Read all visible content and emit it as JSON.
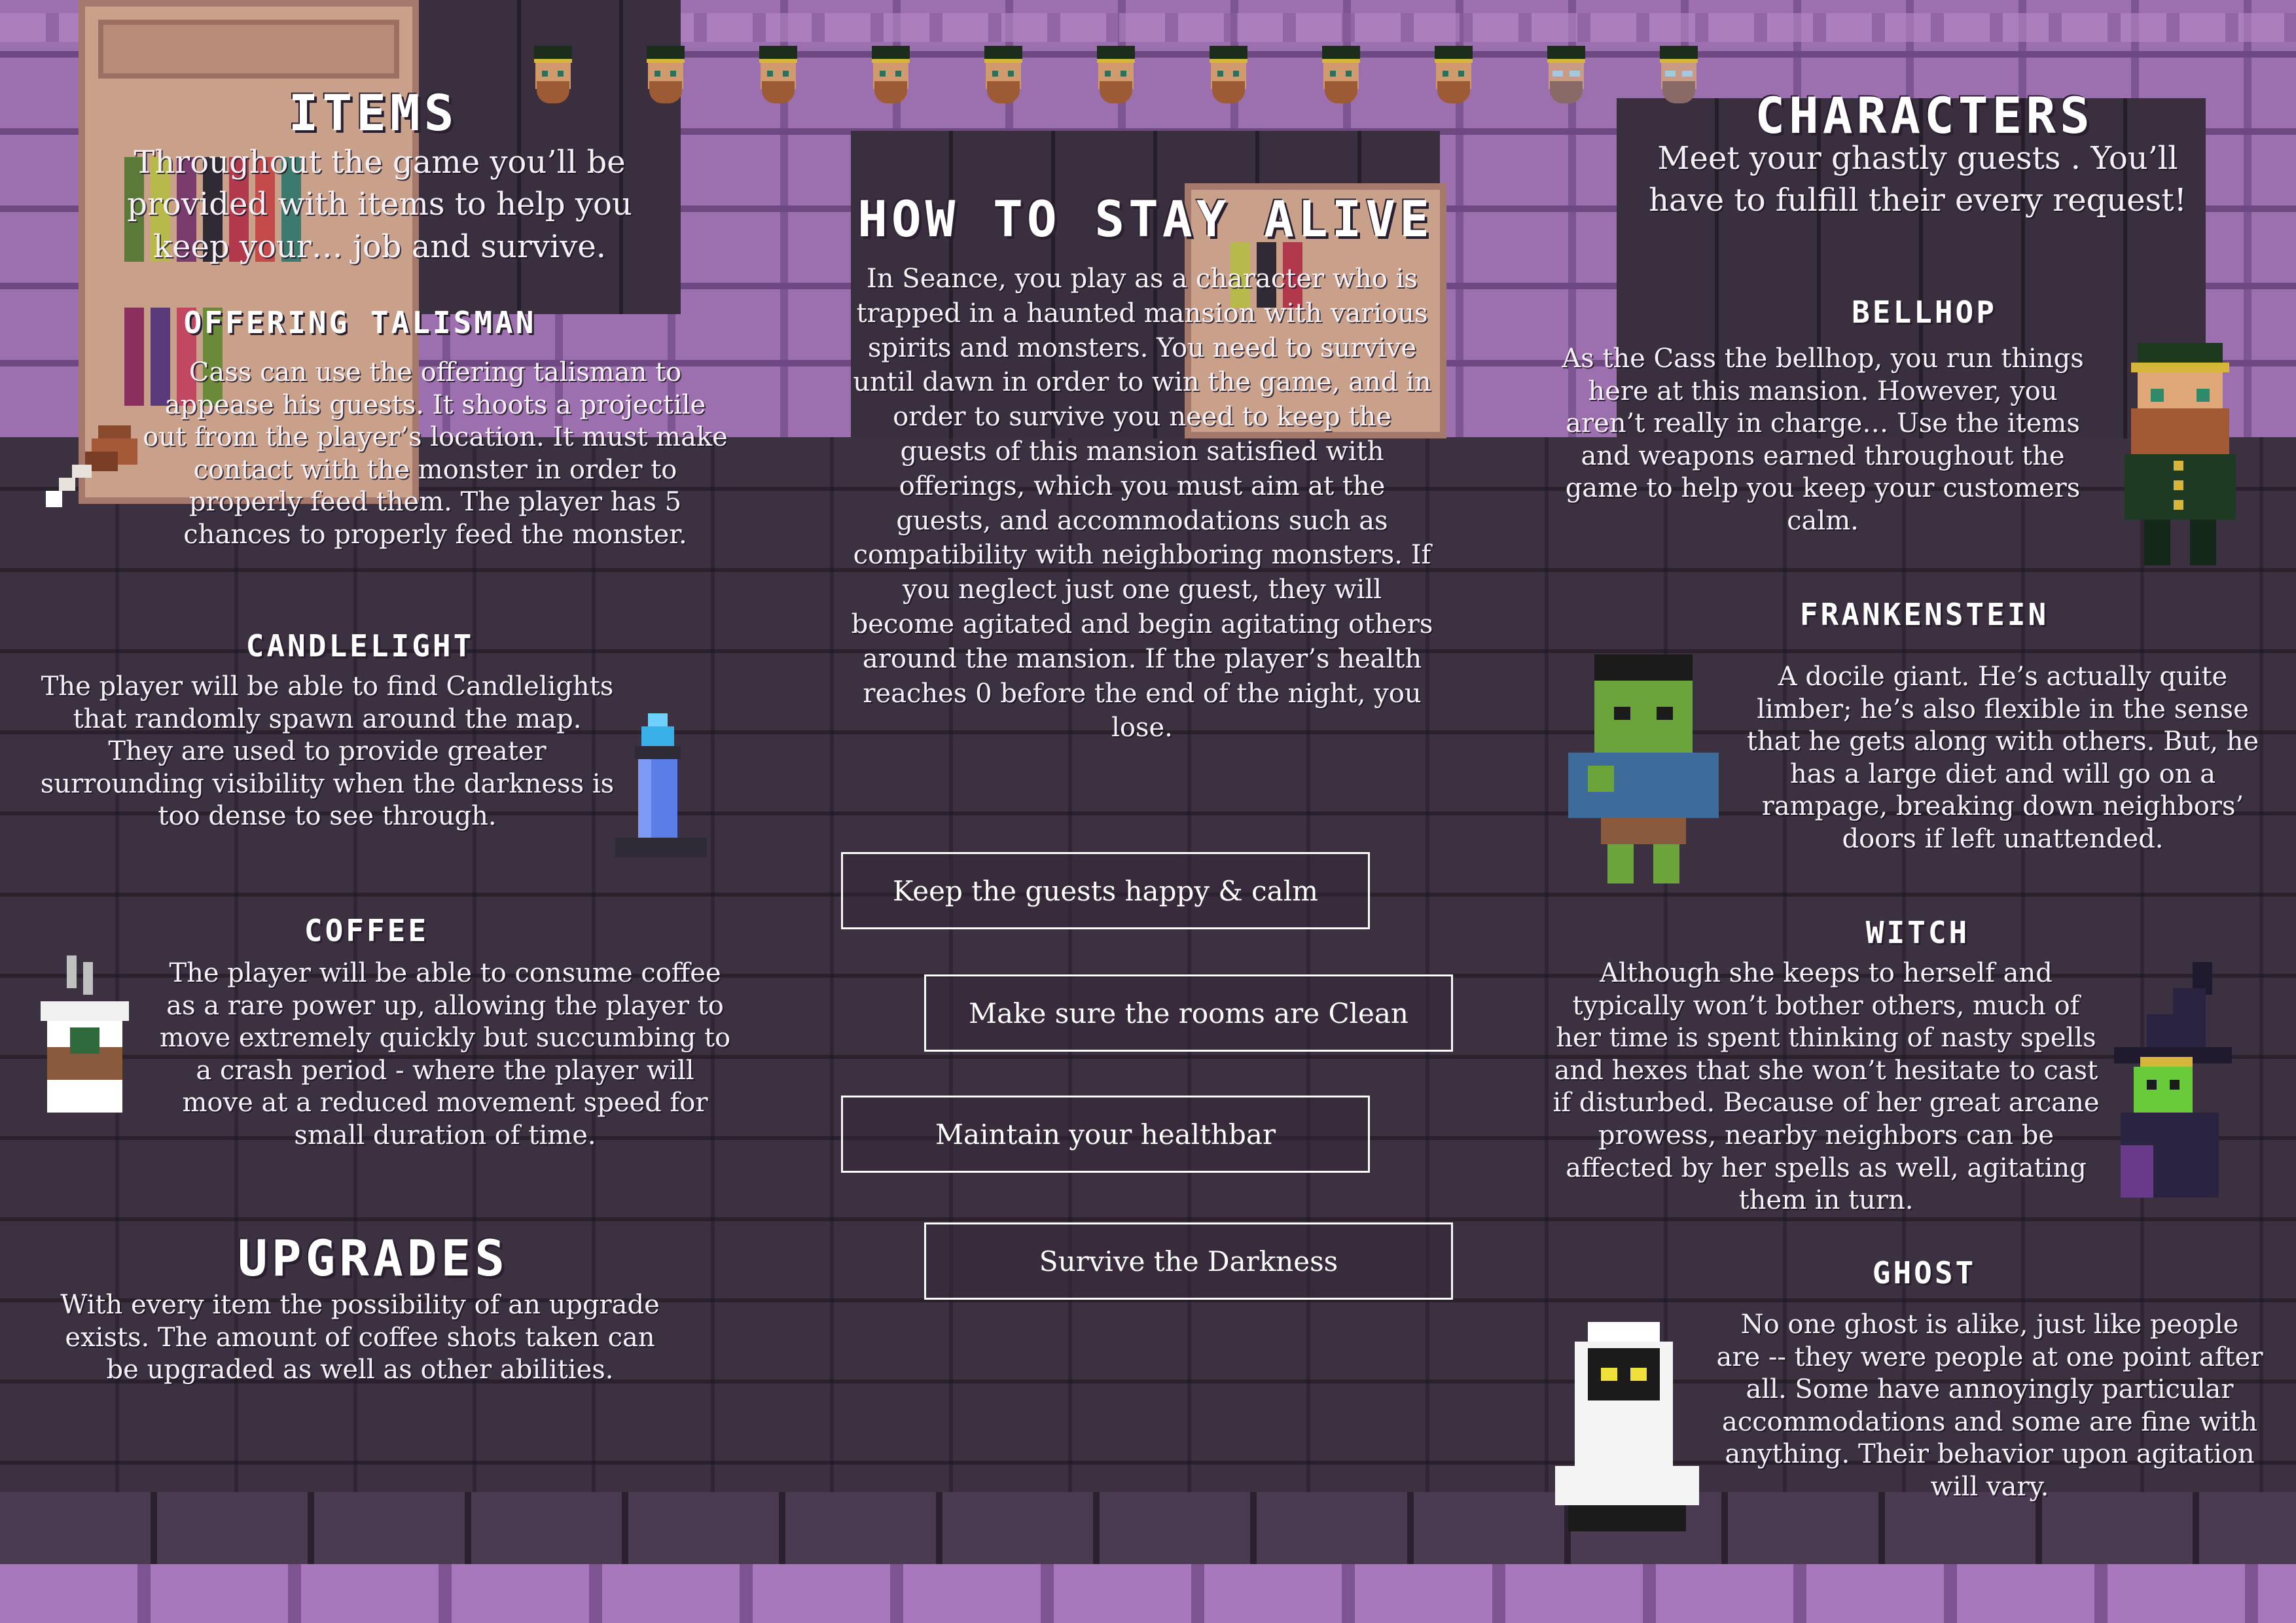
{
  "items": {
    "heading": "ITEMS",
    "intro": "Throughout the game you’ll be provided with items to help you keep your… job and survive.",
    "offering": {
      "title": "OFFERING TALISMAN",
      "text": "Cass can use the offering talisman to appease his guests. It shoots a projectile out from the player’s location. It must make contact with the monster in order to properly feed them. The player has 5 chances to properly feed the monster."
    },
    "candlelight": {
      "title": "CANDLELIGHT",
      "text": "The player will be able to find Candlelights that randomly spawn around the map. They are used to provide greater surrounding visibility when the darkness is too dense to see through."
    },
    "coffee": {
      "title": "COFFEE",
      "text": "The player will be able to consume coffee as a rare power up, allowing the player to move extremely quickly but succumbing to a crash period - where the player will move at a reduced movement speed for small duration of time."
    }
  },
  "upgrades": {
    "heading": "UPGRADES",
    "text": "With every item the possibility of an upgrade exists. The amount of coffee shots taken can be upgraded as well as other abilities."
  },
  "stay_alive": {
    "heading": "HOW TO STAY ALIVE",
    "text": "In Seance, you play as a character who is trapped in a haunted mansion with various spirits and monsters. You need to survive until dawn in order to win the game, and in order to survive you need to keep the guests of this mansion satisfied with offerings, which you must aim at the guests, and accommodations such as compatibility with neighboring monsters. If you neglect just one guest, they will become agitated and begin agitating others around the mansion. If the player’s health reaches 0 before the end of the night, you lose.",
    "goals": [
      "Keep the guests happy & calm",
      "Make sure the rooms are Clean",
      "Maintain your healthbar",
      "Survive the Darkness"
    ]
  },
  "characters": {
    "heading": "CHARACTERS",
    "intro": "Meet your ghastly guests . You’ll have to fulfill their every request!",
    "bellhop": {
      "title": "BELLHOP",
      "text": "As the Cass the bellhop, you run things here at this mansion. However, you aren’t really in charge… Use the items and weapons earned throughout the game to help you keep your customers calm."
    },
    "frankenstein": {
      "title": "FRANKENSTEIN",
      "text": "A docile giant. He’s actually quite limber; he’s also flexible in the sense that he gets along with others. But, he has a large diet and will go on a rampage, breaking down neighbors’ doors if left unattended."
    },
    "witch": {
      "title": "WITCH",
      "text": "Although she keeps to herself and typically won’t bother others, much of her time is spent thinking of nasty spells and hexes that she won’t hesitate to cast if disturbed. Because of her great arcane prowess, nearby neighbors can be affected by her spells as well, agitating them in turn."
    },
    "ghost": {
      "title": "GHOST",
      "text": "No one ghost is alike, just like people are -- they were people at one point after all. Some have annoyingly particular accommodations and some are fine with anything. Their behavior upon agitation will vary."
    }
  },
  "health_heads": {
    "count": 11,
    "normal": 9,
    "hurt": 2
  },
  "colors": {
    "wall": "#9c6fae",
    "background": "#3c3140",
    "box_border": "#ffffff",
    "text": "#f4f0f5"
  },
  "icons": [
    "drumstick-icon",
    "candle-icon",
    "coffee-cup-icon",
    "bellhop-sprite",
    "frankenstein-sprite",
    "witch-sprite",
    "ghost-sprite",
    "bellhop-head-icon"
  ]
}
